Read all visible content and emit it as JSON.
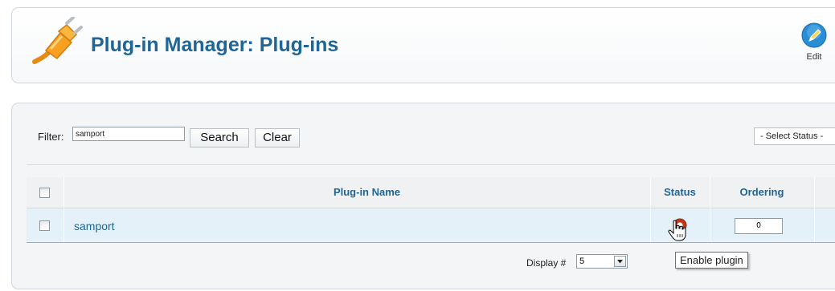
{
  "header": {
    "title": "Plug-in Manager: Plug-ins",
    "edit_label": "Edit",
    "logo_icon": "plug-icon",
    "edit_icon": "pencil-icon"
  },
  "filter": {
    "label": "Filter:",
    "value": "samport",
    "search_label": "Search",
    "clear_label": "Clear",
    "status_select_value": "- Select Status -"
  },
  "table": {
    "headers": {
      "name": "Plug-in Name",
      "status": "Status",
      "ordering": "Ordering"
    },
    "rows": [
      {
        "name": "samport",
        "status": "disabled",
        "ordering": "0"
      }
    ]
  },
  "pagination": {
    "display_label": "Display #",
    "display_value": "5"
  },
  "tooltip": {
    "text": "Enable plugin"
  },
  "colors": {
    "title": "#1f6697",
    "row_highlight": "#e5f1f9",
    "status_disabled": "#c0391b",
    "plug_orange": "#f7a021"
  }
}
